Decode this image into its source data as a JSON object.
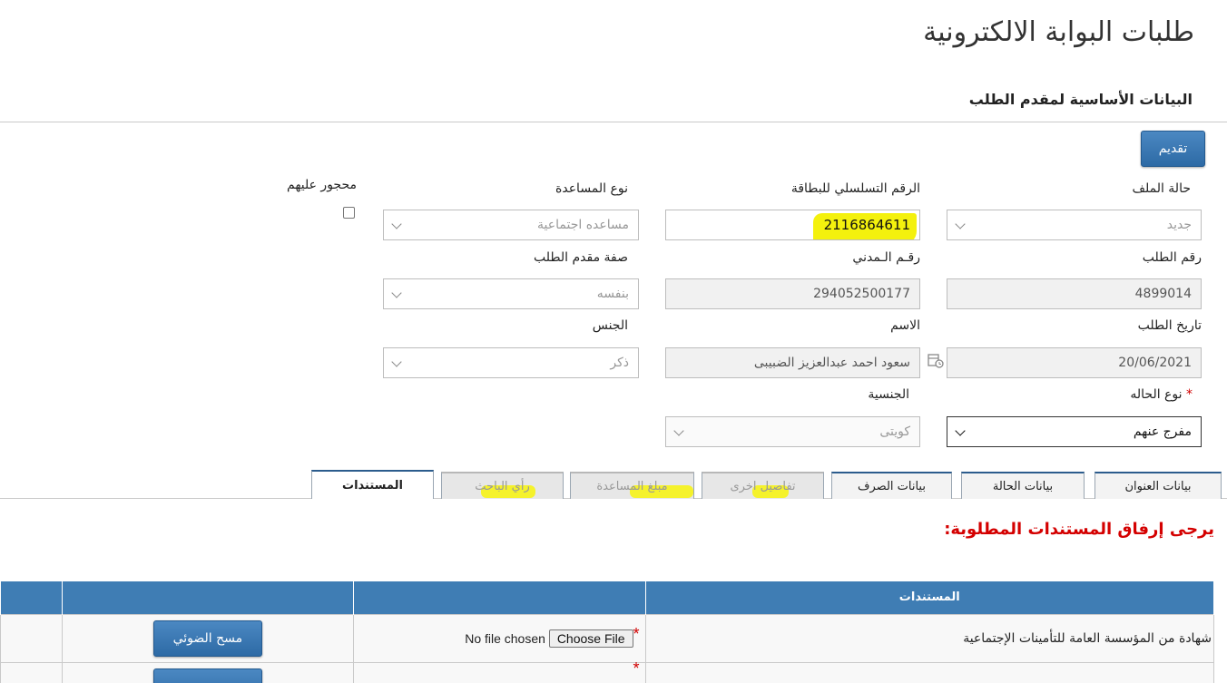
{
  "page": {
    "title": "طلبات البوابة الالكترونية",
    "section_title": "البيانات الأساسية لمقدم الطلب",
    "submit_label": "تقديم"
  },
  "form": {
    "file_status": {
      "label": "حالة الملف",
      "value": "جديد"
    },
    "card_serial": {
      "label": "الرقم التسلسلي للبطاقة",
      "value": "2116864611"
    },
    "assistance_type": {
      "label": "نوع المساعدة",
      "value": "مساعده اجتماعية"
    },
    "restricted": {
      "label": "محجور عليهم",
      "checked": false
    },
    "request_number": {
      "label": "رقم الطلب",
      "value": "4899014"
    },
    "civil_id": {
      "label": "رقـم الـمدني",
      "value": "294052500177"
    },
    "applicant_capacity": {
      "label": "صفة مقدم الطلب",
      "value": "بنفسه"
    },
    "request_date": {
      "label": "تاريخ الطلب",
      "value": "20/06/2021"
    },
    "name": {
      "label": "الاسم",
      "value": "سعود احمد عبدالعزيز الضبيبى"
    },
    "gender": {
      "label": "الجنس",
      "value": "ذكر"
    },
    "case_type": {
      "label": "نوع الحاله",
      "required_mark": "*",
      "value": "مفرج عنهم"
    },
    "nationality": {
      "label": "الجنسية",
      "value": "كويتى"
    }
  },
  "tabs": [
    {
      "label": "بيانات العنوان",
      "state": "normal"
    },
    {
      "label": "بيانات الحالة",
      "state": "normal"
    },
    {
      "label": "بيانات الصرف",
      "state": "normal"
    },
    {
      "label": "تفاصيل اخرى",
      "state": "disabled"
    },
    {
      "label": "مبلغ المساعدة",
      "state": "disabled"
    },
    {
      "label": "رأي الباحث",
      "state": "disabled"
    },
    {
      "label": "المستندات",
      "state": "active"
    }
  ],
  "documents": {
    "heading": "يرجى إرفاق المستندات المطلوبة:",
    "column_header": "المستندات",
    "choose_file_label": "Choose File",
    "no_file_label": "No file chosen",
    "scan_label": "مسح الضوئي",
    "rows": [
      {
        "name": "شهادة من المؤسسة العامة للتأمينات الإجتماعية"
      }
    ]
  },
  "colors": {
    "accent": "#3f7db4",
    "highlight": "#f5f22c",
    "error_red": "#d40000"
  }
}
